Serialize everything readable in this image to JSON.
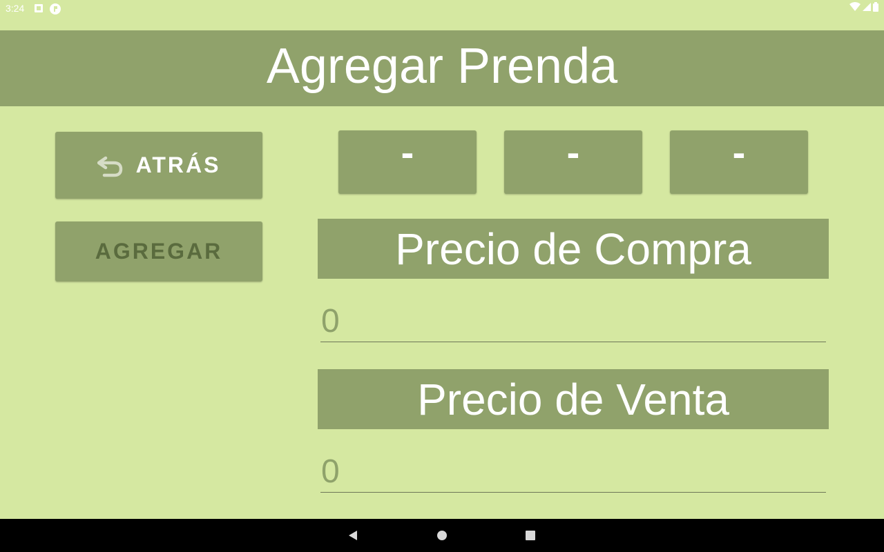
{
  "status_bar": {
    "time": "3:24",
    "icons": [
      "notification-icon",
      "app-icon",
      "wifi-icon",
      "signal-icon",
      "battery-icon"
    ]
  },
  "header": {
    "title": "Agregar Prenda"
  },
  "actions": {
    "back_label": "ATRÁS",
    "back_icon": "undo-arrow-icon",
    "add_label": "AGREGAR"
  },
  "selectors": [
    {
      "label": "-"
    },
    {
      "label": "-"
    },
    {
      "label": "-"
    }
  ],
  "purchase_price": {
    "label": "Precio de Compra",
    "placeholder": "0",
    "value": ""
  },
  "sale_price": {
    "label": "Precio de Venta",
    "placeholder": "0",
    "value": ""
  },
  "navigation": {
    "icons": [
      "nav-back-icon",
      "nav-home-icon",
      "nav-recents-icon"
    ]
  },
  "colors": {
    "background": "#d5e8a1",
    "accent": "#90a26b",
    "text_on_accent": "#ffffff",
    "disabled_text": "#5a6b3e",
    "placeholder": "#8fa26b"
  }
}
